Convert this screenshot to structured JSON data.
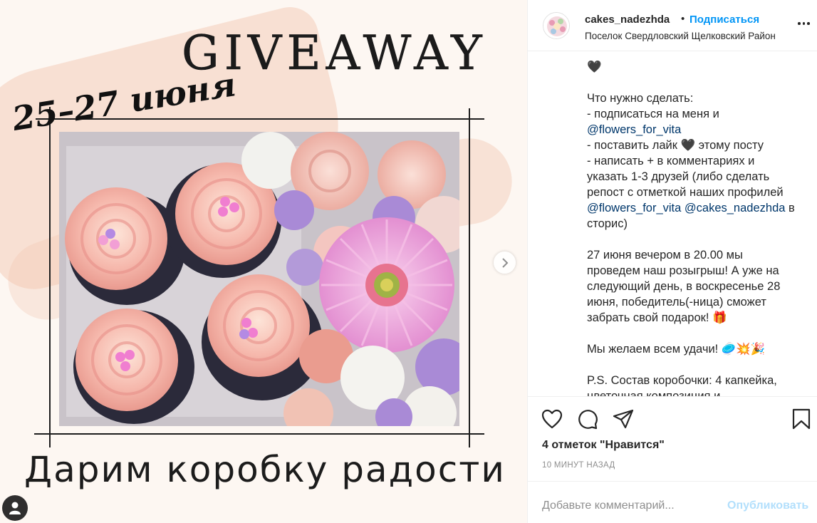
{
  "post": {
    "headline": "GIVEAWAY",
    "dates": "25–27 июня",
    "tagline": "Дарим коробку радости"
  },
  "header": {
    "username": "cakes_nadezhda",
    "separator": "•",
    "follow_label": "Подписаться",
    "location": "Поселок Свердловский Щелковский Район"
  },
  "caption": {
    "line1": "🖤",
    "line2": "Что нужно сделать:",
    "line3": "- подписаться на меня и",
    "line4_mention": "@flowers_for_vita",
    "line5a": "- поставить лайк ",
    "line5_heart": "🖤",
    "line5b": " этому посту",
    "line6": "- написать + в комментариях и",
    "line7": "указать 1-3 друзей (либо сделать",
    "line8": "репост с отметкой наших профилей",
    "line9_mention1": "@flowers_for_vita",
    "line9_mention2": "@cakes_nadezhda",
    "line9_tail": " в",
    "line10": "сторис)",
    "para2_l1": "27 июня вечером в 20.00 мы",
    "para2_l2": "проведем наш розыгрыш! А уже на",
    "para2_l3": "следующий день, в воскресенье 28",
    "para2_l4": "июня, победитель(-ница) сможет",
    "para2_l5": "забрать свой подарок! 🎁",
    "para3": "Мы желаем всем удачи! 🥏💥🎉",
    "para4_l1": "P.S. Состав коробочки: 4 капкейка,",
    "para4_l2": "цветочная композиция и ..."
  },
  "actions": {
    "likes_text": "4 отметок \"Нравится\"",
    "time_text": "10 МИНУТ НАЗАД"
  },
  "comment": {
    "placeholder": "Добавьте комментарий...",
    "publish_label": "Опубликовать"
  },
  "colors": {
    "accent": "#0095f6",
    "publish_disabled": "#b2dffc",
    "mention": "#00376b",
    "text": "#262626",
    "muted": "#8e8e8e"
  },
  "icons": [
    "next-arrow-icon",
    "user-tag-icon",
    "more-icon",
    "heart-icon",
    "comment-icon",
    "share-icon",
    "bookmark-icon"
  ]
}
